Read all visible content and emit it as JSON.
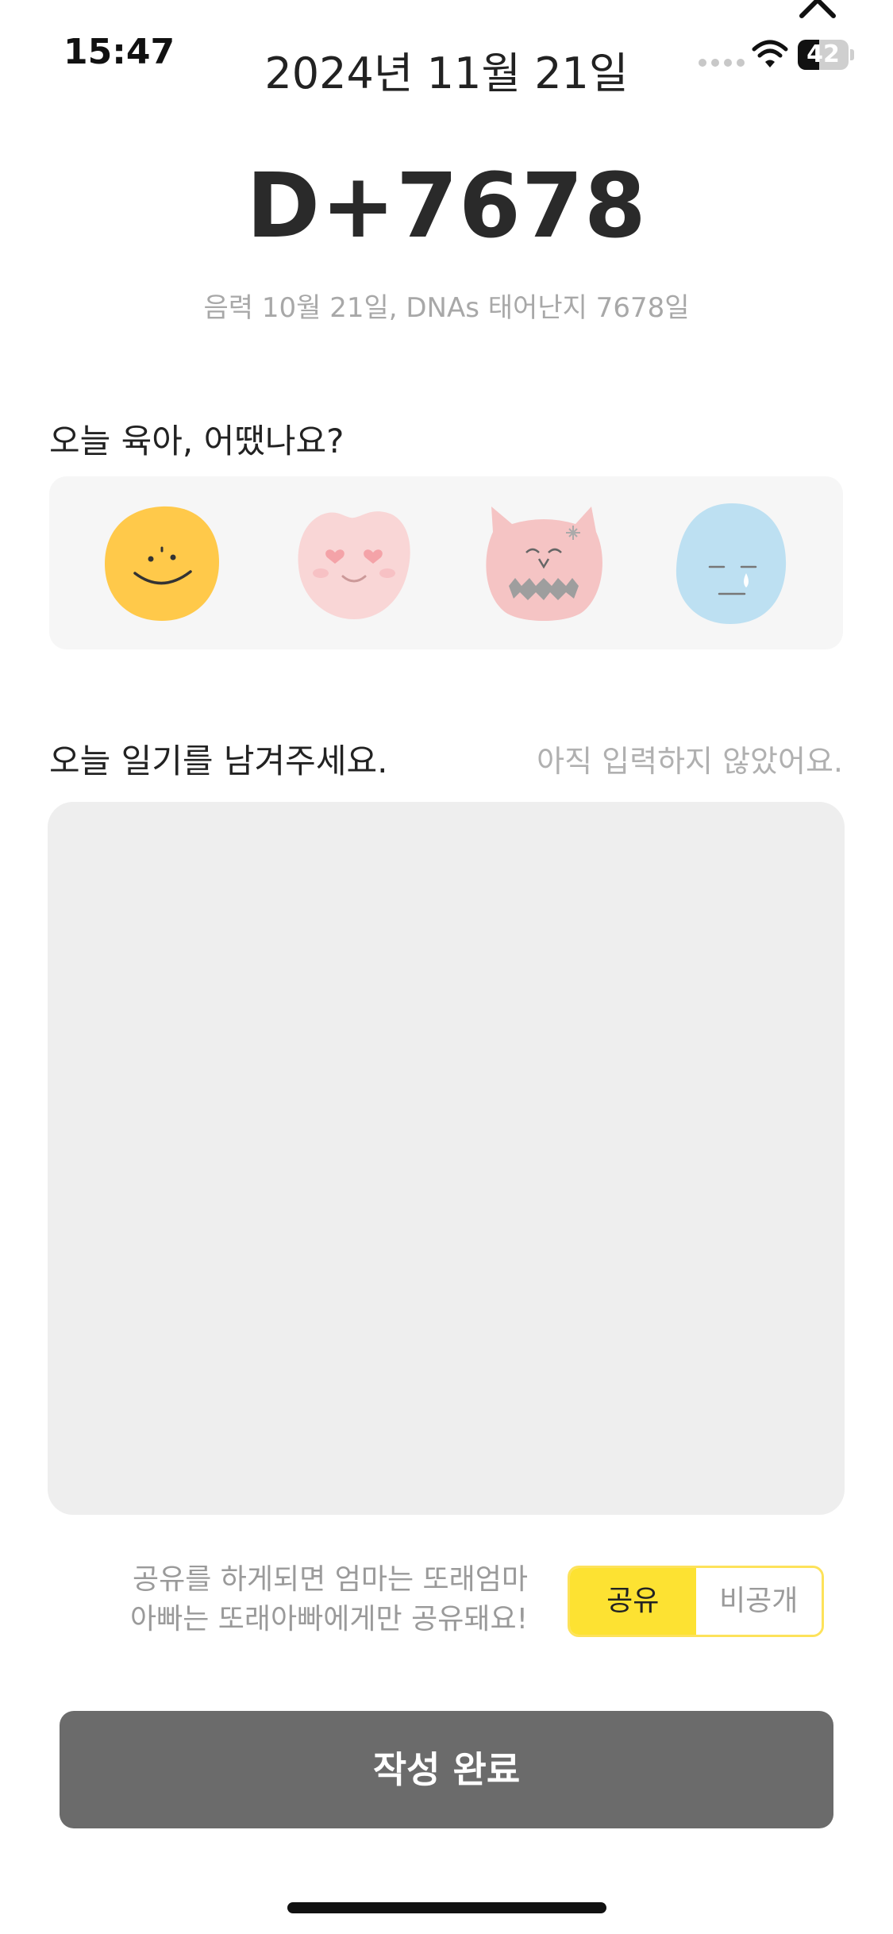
{
  "status_bar": {
    "time": "15:47",
    "battery": "42",
    "battery_level": 0.42
  },
  "header": {
    "date": "2024년 11월 21일",
    "close_icon": "close-chevron-icon"
  },
  "dday": {
    "count": "D+7678",
    "subtitle": "음력 10월 21일, DNAs 태어난지 7678일"
  },
  "mood": {
    "title": "오늘 육아, 어땠나요?",
    "options": [
      {
        "icon": "happy-face-icon",
        "color": "#ffc94a"
      },
      {
        "icon": "love-face-icon",
        "color": "#f9d6d6"
      },
      {
        "icon": "angry-face-icon",
        "color": "#f5c4c4"
      },
      {
        "icon": "sad-face-icon",
        "color": "#bde0f2"
      }
    ]
  },
  "diary": {
    "title": "오늘 일기를 남겨주세요.",
    "status": "아직 입력하지 않았어요.",
    "value": ""
  },
  "share": {
    "note_line1": "공유를 하게되면 엄마는 또래엄마",
    "note_line2": "아빠는 또래아빠에게만 공유돼요!",
    "option_share": "공유",
    "option_private": "비공개",
    "selected": "공유",
    "accent_color": "#fde232"
  },
  "submit": {
    "label": "작성 완료",
    "color": "#6b6b6b"
  }
}
